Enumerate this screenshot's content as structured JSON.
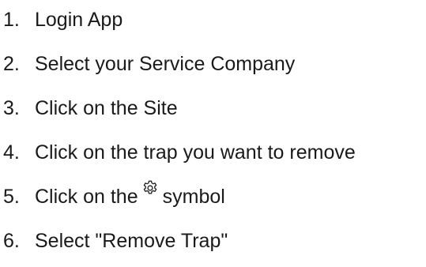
{
  "steps": [
    {
      "number": "1.",
      "text": "Login App"
    },
    {
      "number": "2.",
      "text": "Select your Service Company"
    },
    {
      "number": "3.",
      "text": "Click on the Site"
    },
    {
      "number": "4.",
      "text": "Click on the trap you want to remove"
    },
    {
      "number": "5.",
      "text_before": "Click on the",
      "icon": "gear-icon",
      "text_after": "symbol"
    },
    {
      "number": "6.",
      "text": "Select \"Remove Trap\""
    }
  ]
}
